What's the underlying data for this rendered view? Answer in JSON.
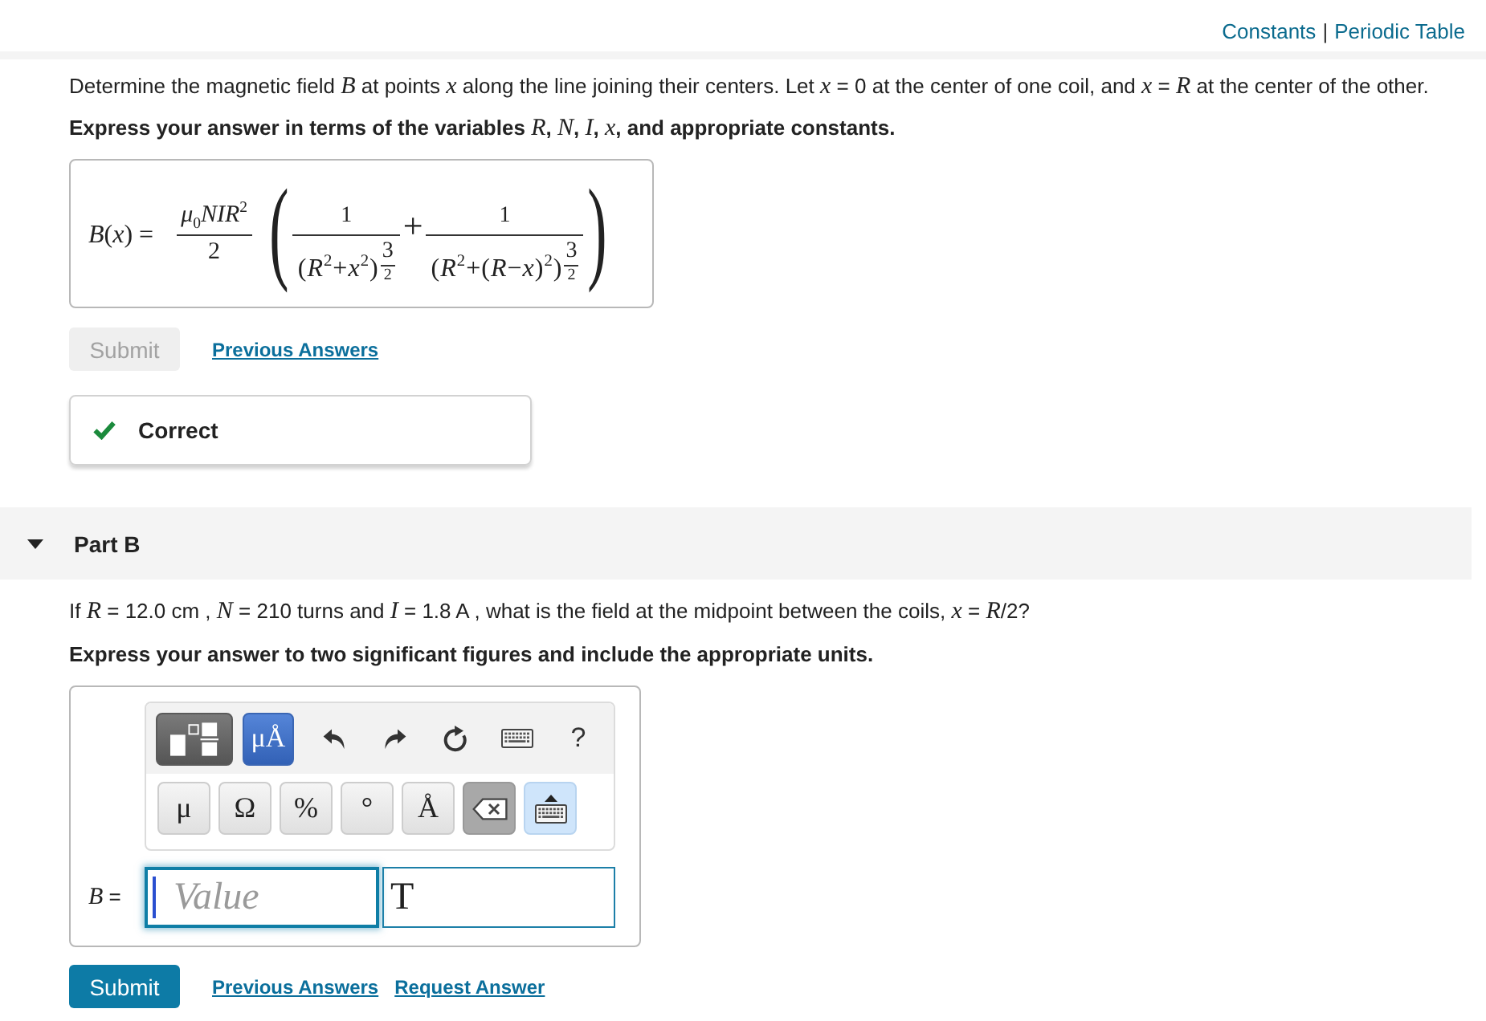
{
  "header": {
    "links": [
      {
        "label": "Constants"
      },
      {
        "label": "Periodic Table"
      }
    ],
    "separator": "|"
  },
  "part_a": {
    "question": "Determine the magnetic field *B* at points *x* along the line joining their centers. Let *x* = 0 at the center of one coil, and *x* = *R* at the center of the other.",
    "instruction": "Express your answer in terms of the variables *R*, *N*, *I*, *x*, and appropriate constants.",
    "answer": {
      "lhs": "*B*(*x*) =",
      "coefficient": {
        "numerator": "*μ*$_{0}$*NIR*$^{2}$",
        "denominator": "2"
      },
      "open": "(",
      "terms": [
        {
          "numerator": "1",
          "base": "(*R*$^{2}$+*x*$^{2}$)",
          "power": {
            "numerator": "3",
            "denominator": "2"
          }
        },
        {
          "numerator": "1",
          "base": "(*R*$^{2}$+(*R*−*x*)$^{2}$)",
          "power": {
            "numerator": "3",
            "denominator": "2"
          }
        }
      ],
      "operator": "+",
      "close": ")"
    },
    "actions": [
      {
        "kind": "submit",
        "label": "Submit",
        "disabled": true
      },
      {
        "kind": "link",
        "label": "Previous Answers"
      }
    ],
    "feedback": {
      "kind": "correct",
      "label": "Correct"
    }
  },
  "part_b": {
    "title": "Part B",
    "expanded": true,
    "question": "If *R* = 12.0 cm , *N* = 210 turns and *I* = 1.8 A , what is the field at the midpoint between the coils, *x* = *R*/2?",
    "instruction": "Express your answer to two significant figures and include the appropriate units.",
    "toolbar": {
      "top": [
        {
          "kind": "templates",
          "selected": false
        },
        {
          "kind": "units",
          "label": "μÅ",
          "selected": true
        },
        {
          "kind": "undo"
        },
        {
          "kind": "redo"
        },
        {
          "kind": "reset"
        },
        {
          "kind": "keyboard"
        },
        {
          "kind": "help",
          "label": "?"
        }
      ],
      "symbols": [
        {
          "kind": "symbol",
          "label": "μ"
        },
        {
          "kind": "symbol",
          "label": "Ω"
        },
        {
          "kind": "symbol",
          "label": "%"
        },
        {
          "kind": "symbol",
          "label": "°"
        },
        {
          "kind": "symbol",
          "label": "Å"
        },
        {
          "kind": "backspace"
        },
        {
          "kind": "keyboard_toggle",
          "selected": true
        }
      ]
    },
    "answer": {
      "label": "*B* =",
      "value": {
        "placeholder": "Value",
        "focused": true
      },
      "unit": {
        "value": "T"
      }
    },
    "actions": [
      {
        "kind": "submit",
        "label": "Submit",
        "disabled": false
      },
      {
        "kind": "link",
        "label": "Previous Answers"
      },
      {
        "kind": "link",
        "label": "Request Answer"
      }
    ]
  }
}
